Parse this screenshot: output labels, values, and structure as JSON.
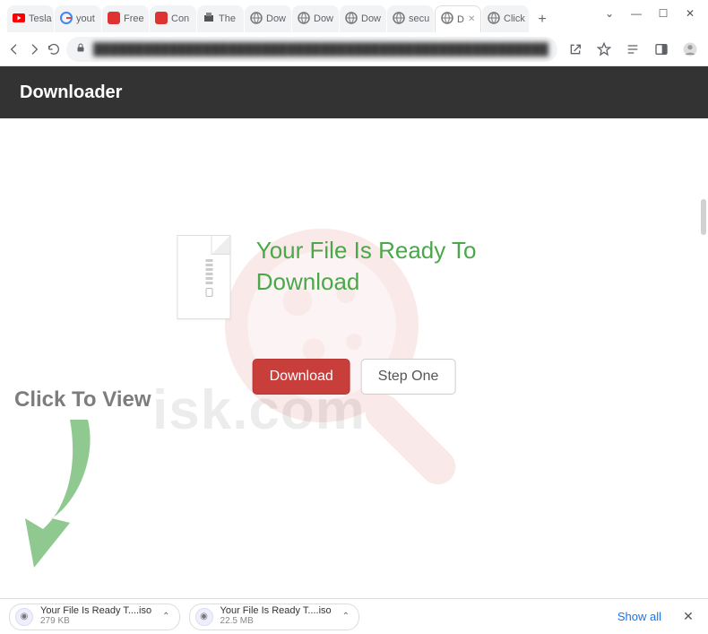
{
  "window": {
    "tabs": [
      {
        "label": "Tesla",
        "favicon": "youtube"
      },
      {
        "label": "yout",
        "favicon": "google"
      },
      {
        "label": "Free",
        "favicon": "red"
      },
      {
        "label": "Con",
        "favicon": "red"
      },
      {
        "label": "The",
        "favicon": "print"
      },
      {
        "label": "Dow",
        "favicon": "globe"
      },
      {
        "label": "Dow",
        "favicon": "globe"
      },
      {
        "label": "Dow",
        "favicon": "globe"
      },
      {
        "label": "secu",
        "favicon": "globe"
      },
      {
        "label": "D",
        "favicon": "globe",
        "active": true
      },
      {
        "label": "Click",
        "favicon": "globe"
      }
    ],
    "new_tab_glyph": "+",
    "controls": {
      "drop": "⌄",
      "min": "—",
      "max": "☐",
      "close": "✕"
    }
  },
  "toolbar": {
    "omnibox_blurred": "██████████████████████████████████████████████████████",
    "icons": {
      "lock": "lock",
      "share": "share",
      "star": "star",
      "ext": "ext",
      "side": "side",
      "avatar": "avatar",
      "menu": "menu"
    }
  },
  "page": {
    "header": "Downloader",
    "heading": "Your File Is Ready To Download",
    "download_btn": "Download",
    "step_btn": "Step One",
    "click_to_view": "Click To View",
    "watermark_text": "isk.com"
  },
  "downloads": {
    "items": [
      {
        "name": "Your File Is Ready T....iso",
        "size": "279 KB"
      },
      {
        "name": "Your File Is Ready T....iso",
        "size": "22.5 MB"
      }
    ],
    "show_all": "Show all"
  }
}
